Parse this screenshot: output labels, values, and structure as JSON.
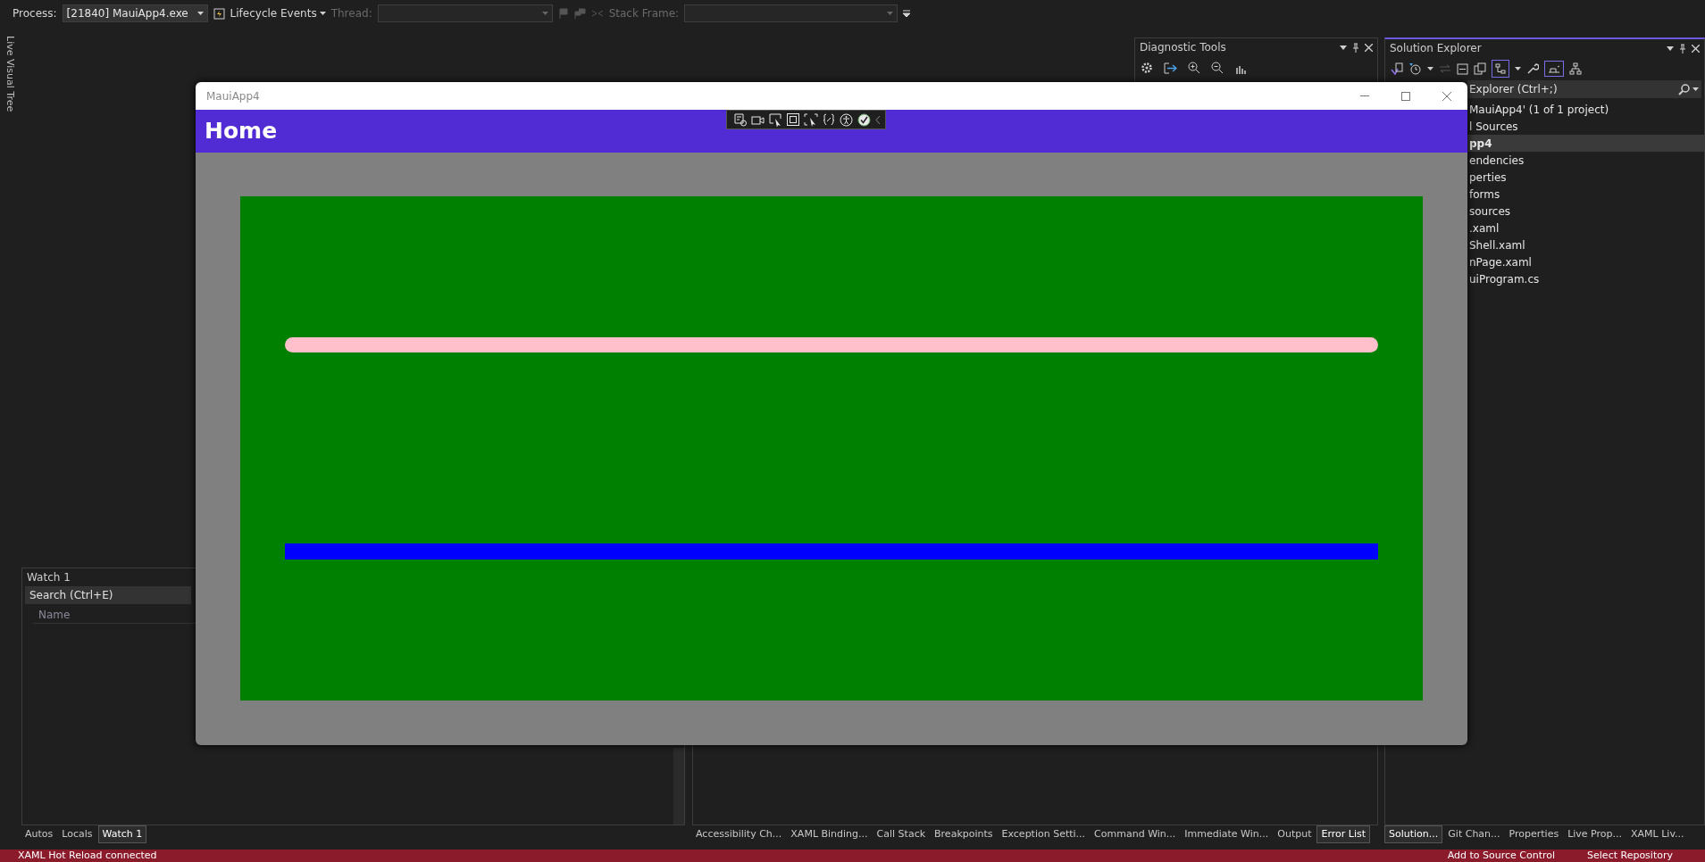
{
  "toolbar": {
    "process_label": "Process:",
    "process": "[21840] MauiApp4.exe",
    "lifecycle": "Lifecycle Events",
    "thread_label": "Thread:",
    "stack_frame_label": "Stack Frame:"
  },
  "side_tab": "Live Visual Tree",
  "diagnostic_tools": {
    "title": "Diagnostic Tools"
  },
  "watch": {
    "title": "Watch 1",
    "search_placeholder": "Search (Ctrl+E)",
    "columns": [
      "Name"
    ],
    "tabs": [
      {
        "label": "Autos",
        "selected": false
      },
      {
        "label": "Locals",
        "selected": false
      },
      {
        "label": "Watch 1",
        "selected": true
      }
    ]
  },
  "output_tabs": [
    {
      "label": "Accessibility Ch...",
      "selected": false
    },
    {
      "label": "XAML Binding...",
      "selected": false
    },
    {
      "label": "Call Stack",
      "selected": false
    },
    {
      "label": "Breakpoints",
      "selected": false
    },
    {
      "label": "Exception Setti...",
      "selected": false
    },
    {
      "label": "Command Win...",
      "selected": false
    },
    {
      "label": "Immediate Win...",
      "selected": false
    },
    {
      "label": "Output",
      "selected": false
    },
    {
      "label": "Error List",
      "selected": true
    }
  ],
  "solution_explorer": {
    "title": "Solution Explorer",
    "search_placeholder": "Explorer (Ctrl+;)",
    "items": [
      {
        "label": "MauiApp4' (1 of 1 project)",
        "selected": false
      },
      {
        "label": "l Sources",
        "selected": false
      },
      {
        "label": "pp4",
        "selected": true
      },
      {
        "label": "endencies",
        "selected": false
      },
      {
        "label": "perties",
        "selected": false
      },
      {
        "label": "forms",
        "selected": false
      },
      {
        "label": "sources",
        "selected": false
      },
      {
        "label": ".xaml",
        "selected": false
      },
      {
        "label": "Shell.xaml",
        "selected": false
      },
      {
        "label": "nPage.xaml",
        "selected": false
      },
      {
        "label": "uiProgram.cs",
        "selected": false
      }
    ],
    "tabs": [
      {
        "label": "Solution...",
        "selected": true
      },
      {
        "label": "Git Chan...",
        "selected": false
      },
      {
        "label": "Properties",
        "selected": false
      },
      {
        "label": "Live Prop...",
        "selected": false
      },
      {
        "label": "XAML Liv...",
        "selected": false
      }
    ]
  },
  "status_bar": {
    "message": "XAML Hot Reload connected",
    "items": [
      "Add to Source Control",
      "Select Repository"
    ]
  },
  "app_window": {
    "title": "MauiApp4",
    "header": "Home",
    "lines": [
      {
        "kind": "rounded",
        "color": "#ffc0cb"
      },
      {
        "kind": "bar",
        "color": "#0000ff"
      }
    ]
  }
}
